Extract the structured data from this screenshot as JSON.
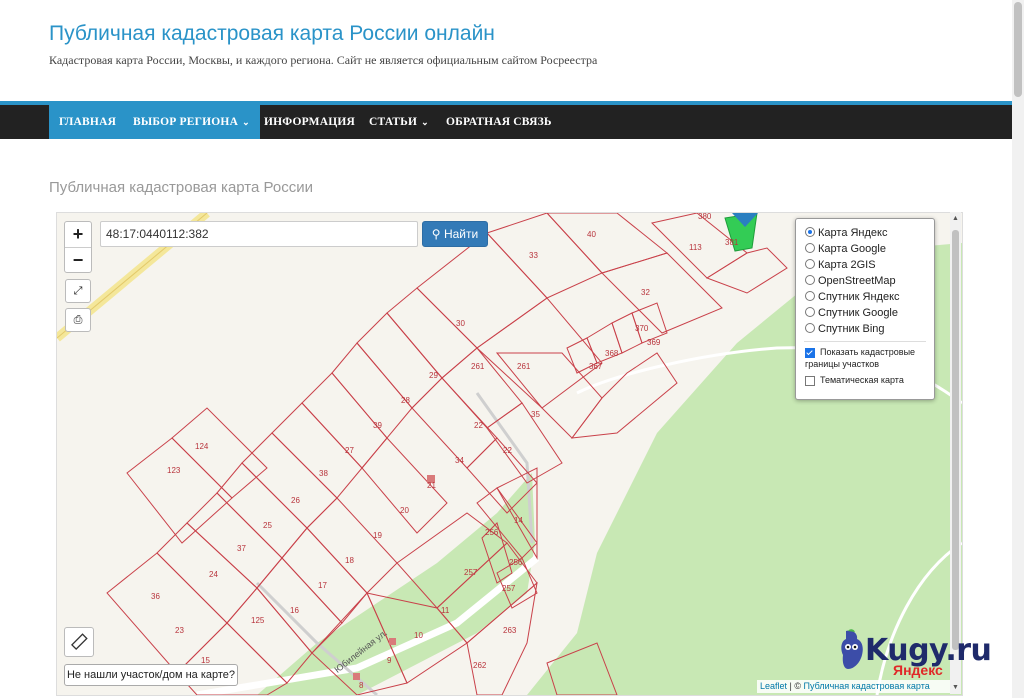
{
  "site": {
    "title": "Публичная кадастровая карта России онлайн",
    "tagline": "Кадастровая карта России, Москвы, и каждого региона. Сайт не является официальным сайтом Росреестра"
  },
  "nav": {
    "items": [
      {
        "label": "ГЛАВНАЯ",
        "active": true
      },
      {
        "label": "ВЫБОР РЕГИОНА",
        "dropdown": true
      },
      {
        "label": "ИНФОРМАЦИЯ"
      },
      {
        "label": "СТАТЬИ",
        "dropdown": true
      },
      {
        "label": "ОБРАТНАЯ СВЯЗЬ"
      }
    ]
  },
  "page": {
    "heading": "Публичная кадастровая карта России"
  },
  "map": {
    "zoom_in": "+",
    "zoom_out": "−",
    "search_value": "48:17:0440112:382",
    "search_button": "Найти",
    "layers": [
      {
        "label": "Карта Яндекс",
        "checked": true
      },
      {
        "label": "Карта Google",
        "checked": false
      },
      {
        "label": "Карта 2GIS",
        "checked": false
      },
      {
        "label": "OpenStreetMap",
        "checked": false
      },
      {
        "label": "Спутник Яндекс",
        "checked": false
      },
      {
        "label": "Спутник Google",
        "checked": false
      },
      {
        "label": "Спутник Bing",
        "checked": false
      }
    ],
    "overlays": [
      {
        "label": "Показать кадастровые границы участков",
        "checked": true
      },
      {
        "label": "Тематическая карта",
        "checked": false
      }
    ],
    "not_found_button": "Не нашли участок/дом на карте?",
    "attribution_leaflet": "Leaflet",
    "attribution_sep": " | © ",
    "attribution_site": "Публичная кадастровая карта",
    "yandex_logo": "Яндекс",
    "street_name": "Юбилейная ул.",
    "plot_numbers": [
      "380",
      "381",
      "113",
      "40",
      "33",
      "32",
      "370",
      "369",
      "368",
      "367",
      "30",
      "261",
      "261",
      "29",
      "28",
      "35",
      "22",
      "22",
      "39",
      "27",
      "34",
      "124",
      "123",
      "38",
      "21",
      "26",
      "20",
      "25",
      "19",
      "14",
      "256",
      "37",
      "18",
      "257",
      "256",
      "24",
      "17",
      "257",
      "11",
      "36",
      "16",
      "125",
      "263",
      "23",
      "10",
      "9",
      "15",
      "262",
      "8"
    ]
  },
  "watermark": {
    "text": "Kugy.ru"
  },
  "colors": {
    "accent": "#2a93c8",
    "nav_bg": "#222222",
    "plot_border": "#c9414a",
    "park": "#c8e8b4",
    "road": "#f4e79a"
  }
}
